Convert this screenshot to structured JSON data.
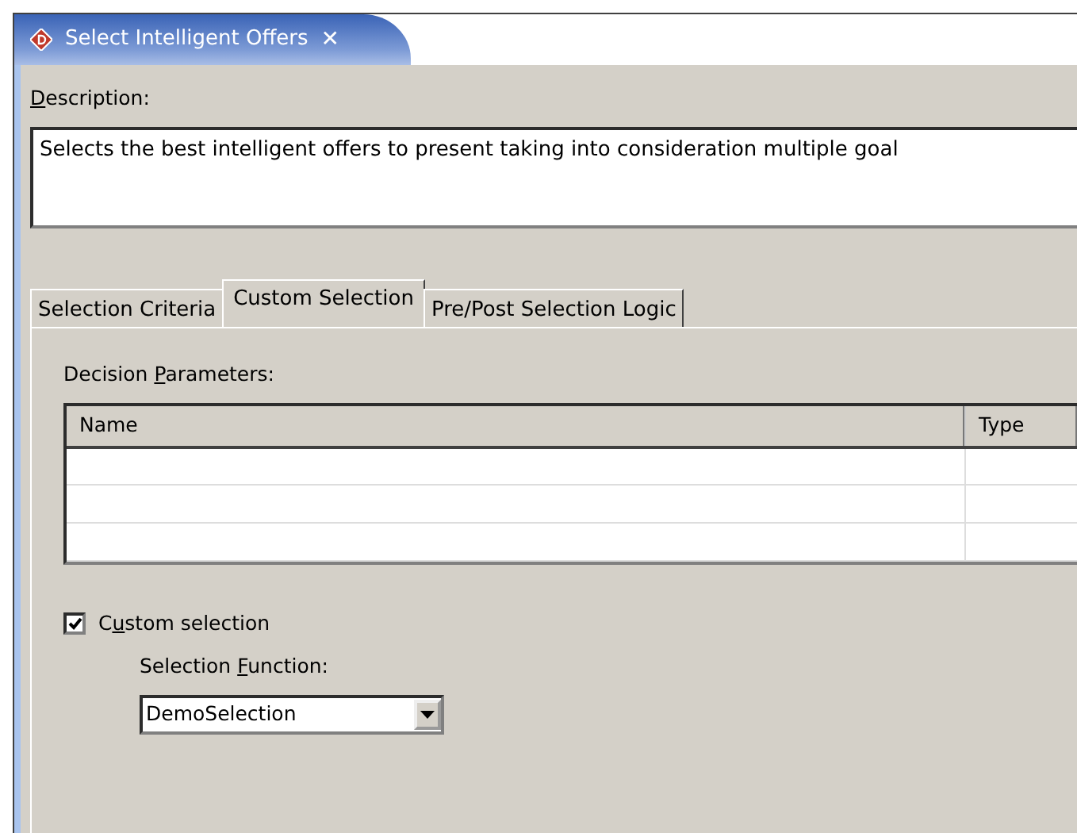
{
  "editor_tab": {
    "title": "Select Intelligent Offers",
    "close": "✕",
    "selected": true
  },
  "description": {
    "mnemonic": "D",
    "label_after": "escription:",
    "value": "Selects the best intelligent offers to present taking into consideration multiple goal"
  },
  "tabs": [
    {
      "label": "Selection Criteria",
      "selected": false
    },
    {
      "label": "Custom Selection",
      "selected": true
    },
    {
      "label": "Pre/Post Selection Logic",
      "selected": false
    }
  ],
  "parameters": {
    "label_before": "Decision ",
    "mnemonic": "P",
    "label_after": "arameters:",
    "columns": [
      "Name",
      "Type"
    ],
    "rows": [
      [
        "",
        ""
      ],
      [
        "",
        ""
      ],
      [
        "",
        ""
      ]
    ]
  },
  "custom_selection": {
    "label_before": "C",
    "mnemonic": "u",
    "label_after": "stom selection",
    "checked": true
  },
  "selection_function": {
    "label_before": "Selection ",
    "mnemonic": "F",
    "label_after": "unction:",
    "value": "DemoSelection"
  }
}
